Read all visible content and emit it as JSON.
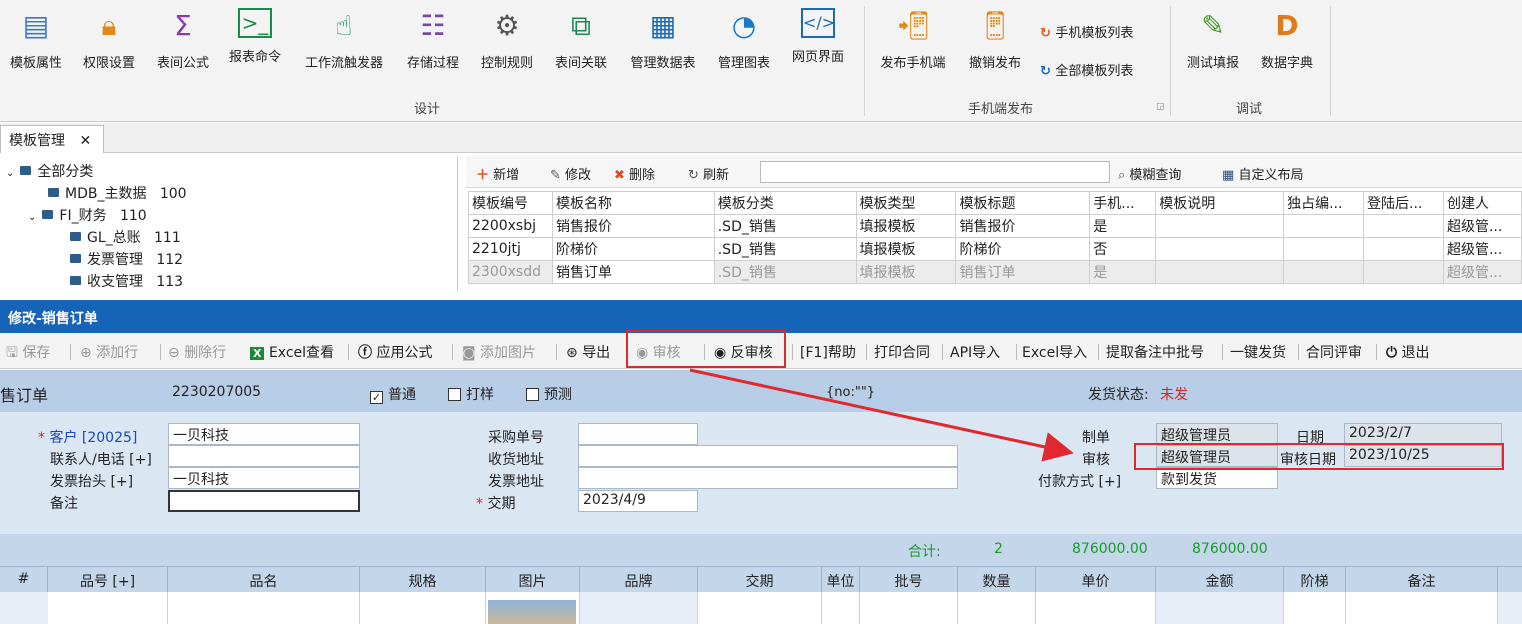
{
  "ribbon": {
    "design_items": [
      "模板属性",
      "权限设置",
      "表间公式",
      "报表命令",
      "工作流触发器",
      "存储过程",
      "控制规则",
      "表间关联",
      "管理数据表",
      "管理图表",
      "网页界面"
    ],
    "design_group": "设计",
    "mobile_items": [
      "发布手机端",
      "撤销发布"
    ],
    "mobile_small": [
      "手机模板列表",
      "全部模板列表"
    ],
    "mobile_group": "手机端发布",
    "debug_items": [
      "测试填报",
      "数据字典"
    ],
    "debug_group": "调试"
  },
  "tab": {
    "label": "模板管理",
    "close": "✕"
  },
  "tree": [
    {
      "label": "全部分类",
      "code": ""
    },
    {
      "label": "MDB_主数据",
      "code": "100"
    },
    {
      "label": "FI_财务",
      "code": "110"
    },
    {
      "label": "GL_总账",
      "code": "111"
    },
    {
      "label": "发票管理",
      "code": "112"
    },
    {
      "label": "收支管理",
      "code": "113"
    }
  ],
  "grid_toolbar": {
    "add": "新增",
    "edit": "修改",
    "delete": "删除",
    "refresh": "刷新",
    "fuzzy": "模糊查询",
    "layout": "自定义布局"
  },
  "grid": {
    "columns": [
      "模板编号",
      "模板名称",
      "模板分类",
      "模板类型",
      "模板标题",
      "手机...",
      "模板说明",
      "独占编...",
      "登陆后...",
      "创建人"
    ],
    "rows": [
      [
        "2200xsbj",
        "销售报价",
        ".SD_销售",
        "填报模板",
        "销售报价",
        "是",
        "",
        "",
        "",
        "超级管..."
      ],
      [
        "2210jtj",
        "阶梯价",
        ".SD_销售",
        "填报模板",
        "阶梯价",
        "否",
        "",
        "",
        "",
        "超级管..."
      ],
      [
        "2300xsdd",
        "销售订单",
        ".SD_销售",
        "填报模板",
        "销售订单",
        "是",
        "",
        "",
        "",
        "超级管..."
      ]
    ]
  },
  "dialog": {
    "title": "修改-销售订单"
  },
  "dialog_toolbar": {
    "save": "保存",
    "add_row": "添加行",
    "del_row": "删除行",
    "excel_view": "Excel查看",
    "apply_formula": "应用公式",
    "add_image": "添加图片",
    "export": "导出",
    "audit": "审核",
    "unaudit": "反审核",
    "help": "[F1]帮助",
    "print_contract": "打印合同",
    "api_import": "API导入",
    "excel_import": "Excel导入",
    "extract_batch": "提取备注中批号",
    "one_ship": "一键发货",
    "contract_review": "合同评审",
    "exit": "退出"
  },
  "header": {
    "title_partial": "售订单",
    "order_no": "2230207005",
    "opt_normal": "普通",
    "opt_sample": "打样",
    "opt_forecast": "预测",
    "no_text": "{no:\"\"}",
    "ship_label": "发货状态:",
    "ship_value": "未发"
  },
  "form": {
    "customer_label": "客户 [20025]",
    "customer": "一贝科技",
    "contact_label": "联系人/电话 [+]",
    "contact": "",
    "invoice_title_label": "发票抬头 [+]",
    "invoice_title": "一贝科技",
    "remark_label": "备注",
    "remark": "",
    "po_label": "采购单号",
    "po": "",
    "ship_addr_label": "收货地址",
    "ship_addr": "",
    "inv_addr_label": "发票地址",
    "inv_addr": "",
    "due_label": "交期",
    "due": "2023/4/9",
    "maker_label": "制单",
    "maker": "超级管理员",
    "date_label": "日期",
    "date": "2023/2/7",
    "auditor_label": "审核",
    "auditor": "超级管理员",
    "audit_date_label": "审核日期",
    "audit_date": "2023/10/25",
    "pay_label": "付款方式 [+]",
    "pay": "款到发货"
  },
  "summary": {
    "label": "合计:",
    "count": "2",
    "sum1": "876000.00",
    "sum2": "876000.00"
  },
  "line_columns": [
    "#",
    "品号 [+]",
    "品名",
    "规格",
    "图片",
    "品牌",
    "交期",
    "单位",
    "批号",
    "数量",
    "单价",
    "金额",
    "阶梯",
    "备注"
  ],
  "colors": {
    "accent": "#1664b8",
    "highlight": "#e0282f",
    "summary": "#1a9a2a"
  }
}
